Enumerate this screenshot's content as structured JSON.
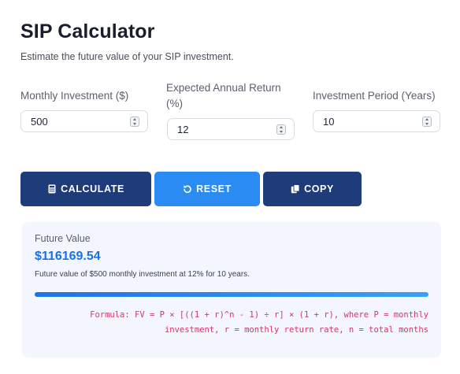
{
  "header": {
    "title": "SIP Calculator",
    "subtitle": "Estimate the future value of your SIP investment."
  },
  "fields": [
    {
      "label": "Monthly Investment ($)",
      "value": "500"
    },
    {
      "label": "Expected Annual Return (%)",
      "value": "12"
    },
    {
      "label": "Investment Period (Years)",
      "value": "10"
    }
  ],
  "buttons": {
    "calculate": "CALCULATE",
    "reset": "RESET",
    "copy": "COPY"
  },
  "result": {
    "label": "Future Value",
    "value": "$116169.54",
    "description": "Future value of $500 monthly investment at 12% for 10 years.",
    "progress": 1.0,
    "formula": "Formula: FV = P × [((1 + r)^n - 1) ÷ r] × (1 + r), where P = monthly investment, r = monthly return rate, n = total months"
  },
  "colors": {
    "primary_dark": "#1e3b7a",
    "primary_light": "#2a8bf2",
    "accent_value": "#1a70e8",
    "formula": "#d6336c",
    "result_bg": "#f3f6fd"
  },
  "icons": {
    "calculate": "calculator-icon",
    "reset": "undo-icon",
    "copy": "copy-icon",
    "stepper": "stepper-icon"
  }
}
